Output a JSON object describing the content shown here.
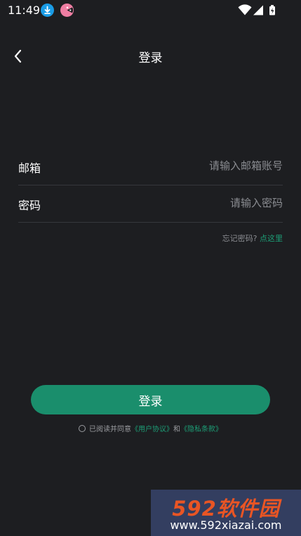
{
  "status_bar": {
    "time": "11:49",
    "notification_icons": [
      "download-icon",
      "pacman-icon"
    ],
    "system_icons": [
      "wifi-icon",
      "signal-icon",
      "battery-charging-icon"
    ]
  },
  "header": {
    "back_icon": "chevron-left-icon",
    "title": "登录"
  },
  "form": {
    "email": {
      "label": "邮箱",
      "value": "",
      "placeholder": "请输入邮箱账号"
    },
    "password": {
      "label": "密码",
      "value": "",
      "placeholder": "请输入密码"
    },
    "forgot_text": "忘记密码?",
    "forgot_link": "点这里"
  },
  "login_button_label": "登录",
  "agreement": {
    "checked": false,
    "prefix": "已阅读并同意",
    "user_agreement": "《用户协议》",
    "connector": "和",
    "privacy_policy": "《隐私条款》"
  },
  "watermark": {
    "logo": "592软件园",
    "url": "www.592xiazai.com"
  },
  "colors": {
    "background": "#1d1e21",
    "accent": "#1a8e6c",
    "link": "#1d9e76"
  }
}
